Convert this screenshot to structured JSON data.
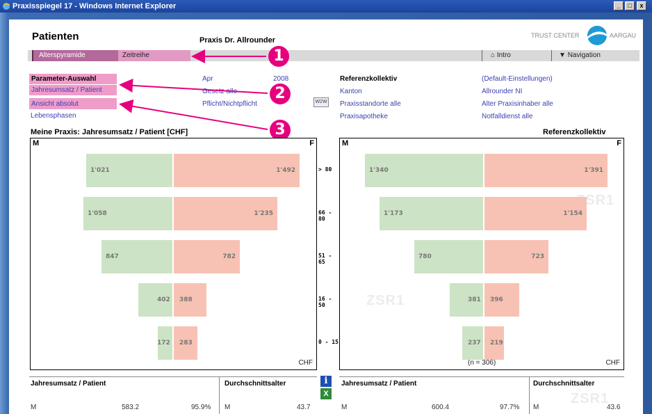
{
  "window": {
    "title": "Praxisspiegel 17 - Windows Internet Explorer",
    "min": "_",
    "max": "□",
    "close": "x"
  },
  "header": {
    "page_title": "Patienten",
    "praxis_name": "Praxis Dr. Allrounder",
    "logo_left": "TRUST CENTER",
    "logo_right": "AARGAU"
  },
  "nav": {
    "tab_alters": "Alterspyramide",
    "tab_zeit": "Zeitreihe",
    "intro": "Intro",
    "navigation": "Navigation"
  },
  "params": {
    "title": "Parameter-Auswahl",
    "jahresumsatz": "Jahresumsatz / Patient",
    "ansicht": "Ansicht absolut",
    "lebensphasen": "Lebensphasen",
    "month": "Apr",
    "year": "2008",
    "gesetz": "Gesetz alle",
    "pflicht": "Pflicht/Nichtpflicht",
    "w2w": "W2W"
  },
  "referenz": {
    "title": "Referenzkollektiv",
    "default": "(Default-Einstellungen)",
    "kanton": "Kanton",
    "allrounder": "Allrounder NI",
    "standorte": "Praxisstandorte alle",
    "alter": "Alter Praxisinhaber alle",
    "apotheke": "Praxisapotheke",
    "notfall": "Notfalldienst alle"
  },
  "badges": [
    "1",
    "2",
    "3"
  ],
  "chart_left_title": "Meine Praxis: Jahresumsatz / Patient [CHF]",
  "chart_right_title": "Referenzkollektiv",
  "chart_labels": {
    "m": "M",
    "f": "F",
    "unit": "CHF",
    "n": "(n = 306)",
    "watermark": "ZSR1"
  },
  "age_groups": [
    "> 80",
    "66 - 80",
    "51 - 65",
    "16 - 50",
    "0 - 15"
  ],
  "chart_data": [
    {
      "type": "bar",
      "title": "Meine Praxis: Jahresumsatz / Patient [CHF]",
      "categories": [
        "> 80",
        "66 - 80",
        "51 - 65",
        "16 - 50",
        "0 - 15"
      ],
      "series": [
        {
          "name": "M",
          "values": [
            1021,
            1058,
            847,
            402,
            172
          ],
          "labels": [
            "1'021",
            "1'058",
            "847",
            "402",
            "172"
          ],
          "color": "#cde3c5"
        },
        {
          "name": "F",
          "values": [
            1492,
            1235,
            782,
            388,
            283
          ],
          "labels": [
            "1'492",
            "1'235",
            "782",
            "388",
            "283"
          ],
          "color": "#f7c2b3"
        }
      ]
    },
    {
      "type": "bar",
      "title": "Referenzkollektiv",
      "categories": [
        "> 80",
        "66 - 80",
        "51 - 65",
        "16 - 50",
        "0 - 15"
      ],
      "series": [
        {
          "name": "M",
          "values": [
            1340,
            1173,
            780,
            381,
            237
          ],
          "labels": [
            "1'340",
            "1'173",
            "780",
            "381",
            "237"
          ],
          "color": "#cde3c5"
        },
        {
          "name": "F",
          "values": [
            1391,
            1154,
            723,
            396,
            219
          ],
          "labels": [
            "1'391",
            "1'154",
            "723",
            "396",
            "219"
          ],
          "color": "#f7c2b3"
        }
      ]
    }
  ],
  "table": {
    "h_jahres": "Jahresumsatz / Patient",
    "h_durch": "Durchschnittsalter",
    "left": {
      "label": "M",
      "value": "583.2",
      "pct": "95.9%",
      "age_label": "M",
      "age": "43.7"
    },
    "right": {
      "label": "M",
      "value": "600.4",
      "pct": "97.7%",
      "age_label": "M",
      "age": "43.6"
    }
  }
}
